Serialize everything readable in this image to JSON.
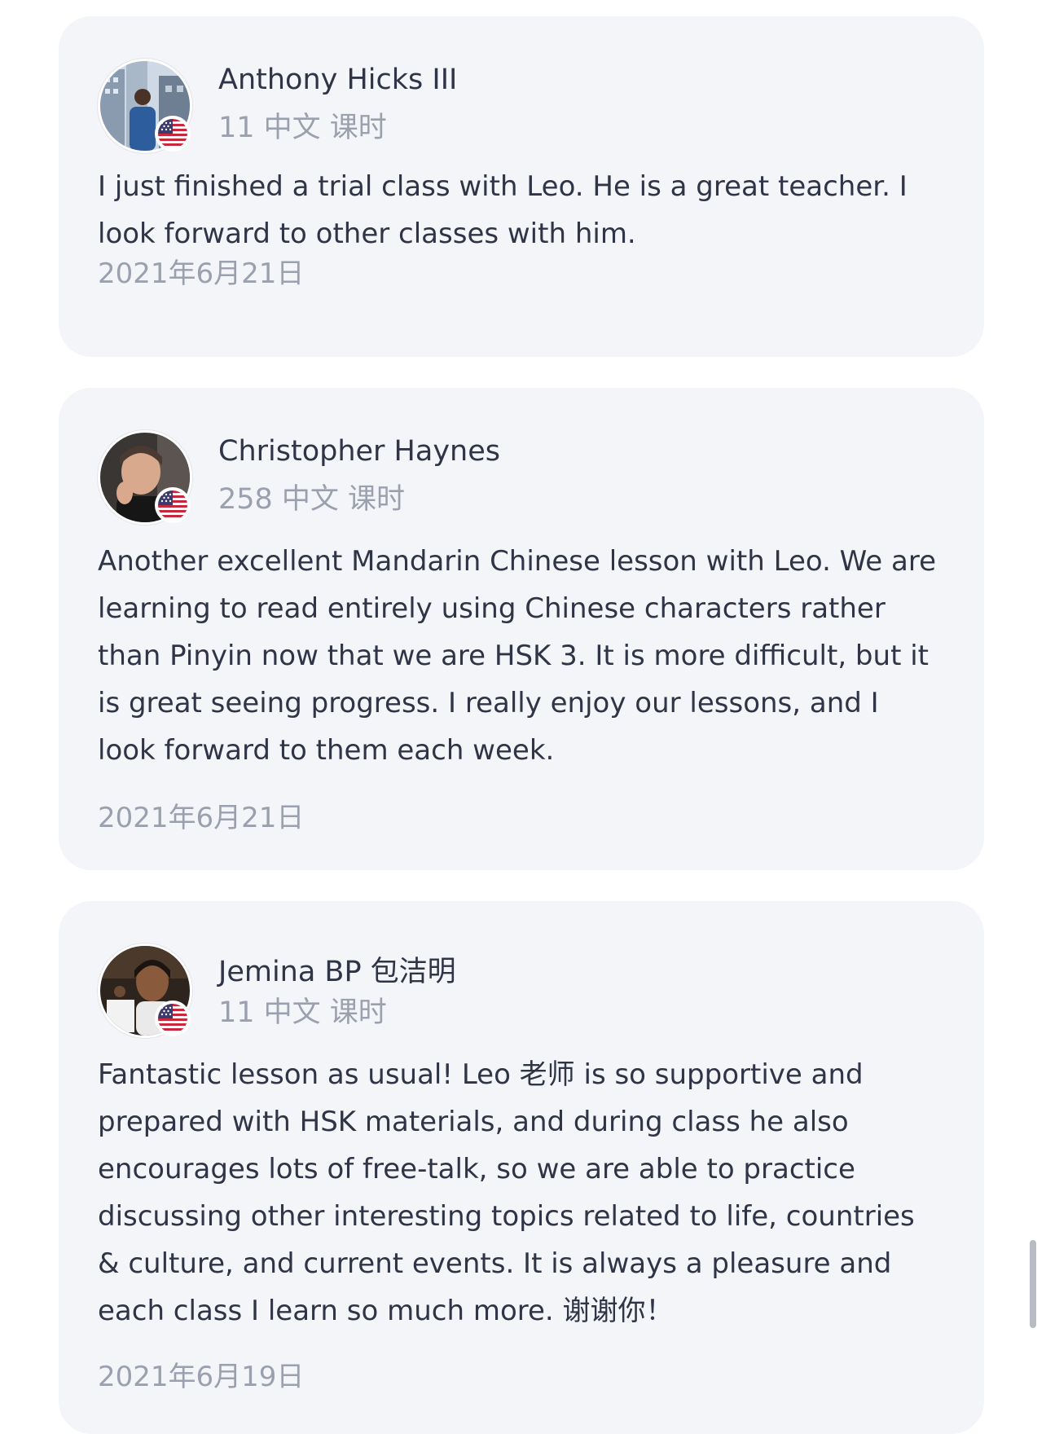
{
  "reviews": [
    {
      "name": "Anthony Hicks III",
      "lessons": "11 中文 课时",
      "text": "I just finished a trial class with Leo. He is a great teacher. I\nlook forward to other classes with him.",
      "date": "2021年6月21日",
      "avatar_icon": "user-photo-city-icon",
      "flag_icon": "us-flag-icon"
    },
    {
      "name": "Christopher Haynes",
      "lessons": "258 中文 课时",
      "text": "Another excellent Mandarin Chinese lesson with Leo. We are\nlearning to read entirely using Chinese characters rather\nthan Pinyin now that we are HSK 3. It is more difficult, but it\nis great seeing progress. I really enjoy our lessons, and I\nlook forward to them each week.",
      "date": "2021年6月21日",
      "avatar_icon": "user-photo-portrait-icon",
      "flag_icon": "us-flag-icon"
    },
    {
      "name": "Jemina BP 包洁明",
      "lessons": "11 中文 课时",
      "text": "Fantastic lesson as usual! Leo 老师 is so supportive and\nprepared with HSK materials, and during class he also\nencourages lots of free-talk, so we are able to practice\ndiscussing other interesting topics related to life, countries\n& culture, and current events. It is always a pleasure and\neach class I learn so much more. 谢谢你！",
      "date": "2021年6月19日",
      "avatar_icon": "user-photo-portrait-icon",
      "flag_icon": "us-flag-icon"
    }
  ],
  "colors": {
    "card_background": "#f4f5f9",
    "name_text": "#2f3446",
    "muted_text": "#9aa0ad",
    "flag_red": "#c8283c",
    "flag_blue": "#3c3b6e"
  }
}
